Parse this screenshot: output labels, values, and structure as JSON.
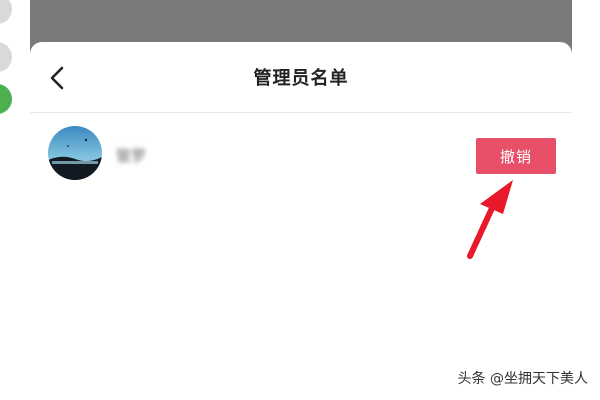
{
  "header": {
    "title": "管理员名单",
    "back_icon": "chevron-left-icon"
  },
  "admins": [
    {
      "name": "管罗",
      "action_label": "撤销"
    }
  ],
  "colors": {
    "accent": "#e8506a",
    "arrow": "#e8192b",
    "backdrop": "#7a7a7a"
  },
  "watermark": {
    "text": "头条 @坐拥天下美人"
  }
}
